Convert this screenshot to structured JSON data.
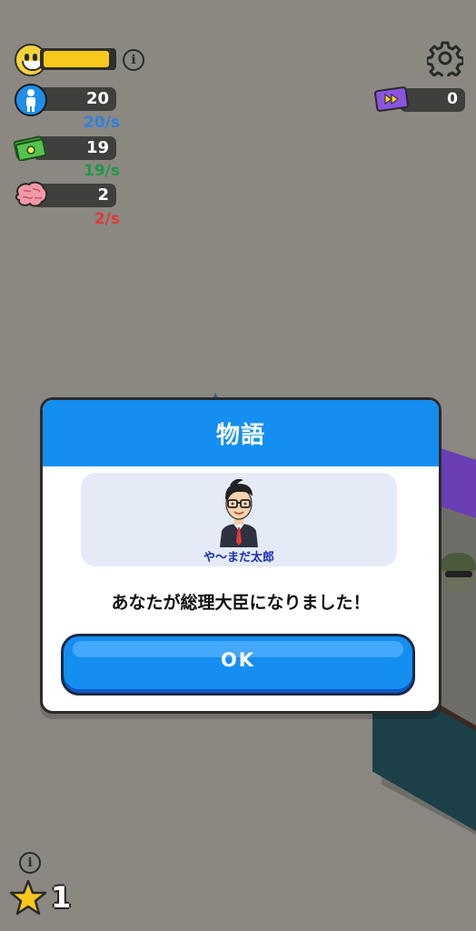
{
  "hud": {
    "happiness": {
      "level": 0.95,
      "icon": "smiley-face-icon"
    },
    "population": {
      "value": "20",
      "rate": "20/s",
      "rate_color": "#2f7fe0",
      "icon": "person-icon"
    },
    "money": {
      "value": "19",
      "rate": "19/s",
      "rate_color": "#1e9a48",
      "icon": "cash-icon"
    },
    "brain": {
      "value": "2",
      "rate": "2/s",
      "rate_color": "#e03a3a",
      "icon": "brain-icon"
    },
    "info_glyph": "i",
    "fast_forward_tickets": {
      "value": "0",
      "icon": "fast-forward-ticket-icon"
    }
  },
  "dialog": {
    "title": "物語",
    "character_name": "や〜まだ太郎",
    "message": "あなたが総理大臣になりました！",
    "ok_label": "OK"
  },
  "bottom": {
    "info_glyph": "i",
    "stars": "1"
  },
  "colors": {
    "dialog_blue": "#148ef0",
    "background": "#8a8881"
  }
}
